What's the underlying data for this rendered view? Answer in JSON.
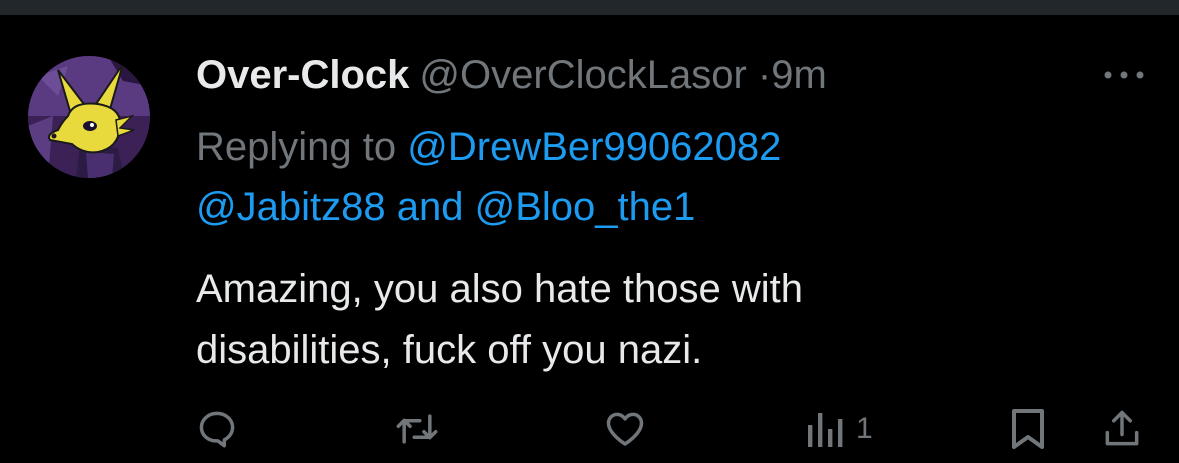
{
  "tweet": {
    "display_name": "Over-Clock",
    "handle": "@OverClockLasor",
    "separator": "·",
    "time": "9m",
    "replying_prefix": "Replying to",
    "reply_mentions": [
      "@DrewBer99062082",
      "@Jabitz88",
      "@Bloo_the1"
    ],
    "reply_and": "and",
    "text_lines": [
      "Amazing, you also hate those with",
      "disabilities, fuck off you nazi."
    ]
  },
  "actions": {
    "reply_icon": "reply-icon",
    "retweet_icon": "retweet-icon",
    "like_icon": "heart-icon",
    "views_icon": "views-icon",
    "views_count": "1",
    "bookmark_icon": "bookmark-icon",
    "share_icon": "share-icon"
  },
  "colors": {
    "background": "#000000",
    "top_bar": "#22272c",
    "primary_text": "#e7e9ea",
    "secondary_text": "#71767b",
    "accent_link": "#1d9bf0",
    "avatar_yellow": "#e8d93c",
    "avatar_purple": "#4a2a6a"
  }
}
